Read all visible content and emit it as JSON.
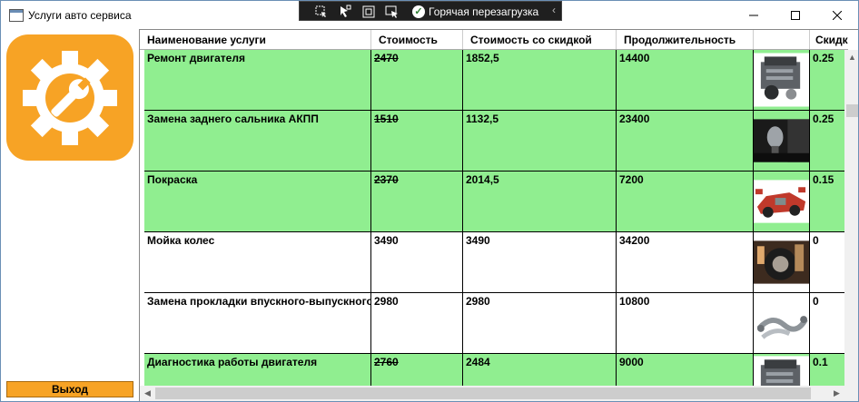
{
  "window": {
    "title": "Услуги авто сервиса"
  },
  "debug_toolbar": {
    "hot_reload_label": "Горячая перезагрузка"
  },
  "exit_button": {
    "label": "Выход"
  },
  "colors": {
    "accent": "#f7a325",
    "discount_row": "#90ee90",
    "plain_row": "#ffffff"
  },
  "table": {
    "headers": [
      "Наименование услуги",
      "Стоимость",
      "Стоимость со скидкой",
      "Продолжительность",
      "",
      "Скидка"
    ],
    "rows": [
      {
        "name": "Ремонт двигателя",
        "cost": "2470",
        "discounted": "1852,5",
        "duration": "14400",
        "image": "engine-image",
        "discount": "0.25",
        "has_discount": true
      },
      {
        "name": "Замена заднего сальника АКПП",
        "cost": "1510",
        "discounted": "1132,5",
        "duration": "23400",
        "image": "gearshift-image",
        "discount": "0.25",
        "has_discount": true
      },
      {
        "name": "Покраска",
        "cost": "2370",
        "discounted": "2014,5",
        "duration": "7200",
        "image": "car-parts-image",
        "discount": "0.15",
        "has_discount": true
      },
      {
        "name": "Мойка колес",
        "cost": "3490",
        "discounted": "3490",
        "duration": "34200",
        "image": "wheel-wash-image",
        "discount": "0",
        "has_discount": false
      },
      {
        "name": "Замена прокладки впускного-выпускного коллектора",
        "cost": "2980",
        "discounted": "2980",
        "duration": "10800",
        "image": "manifold-image",
        "discount": "0",
        "has_discount": false
      },
      {
        "name": "Диагностика работы двигателя",
        "cost": "2760",
        "discounted": "2484",
        "duration": "9000",
        "image": "engine-image",
        "discount": "0.1",
        "has_discount": true
      }
    ]
  }
}
